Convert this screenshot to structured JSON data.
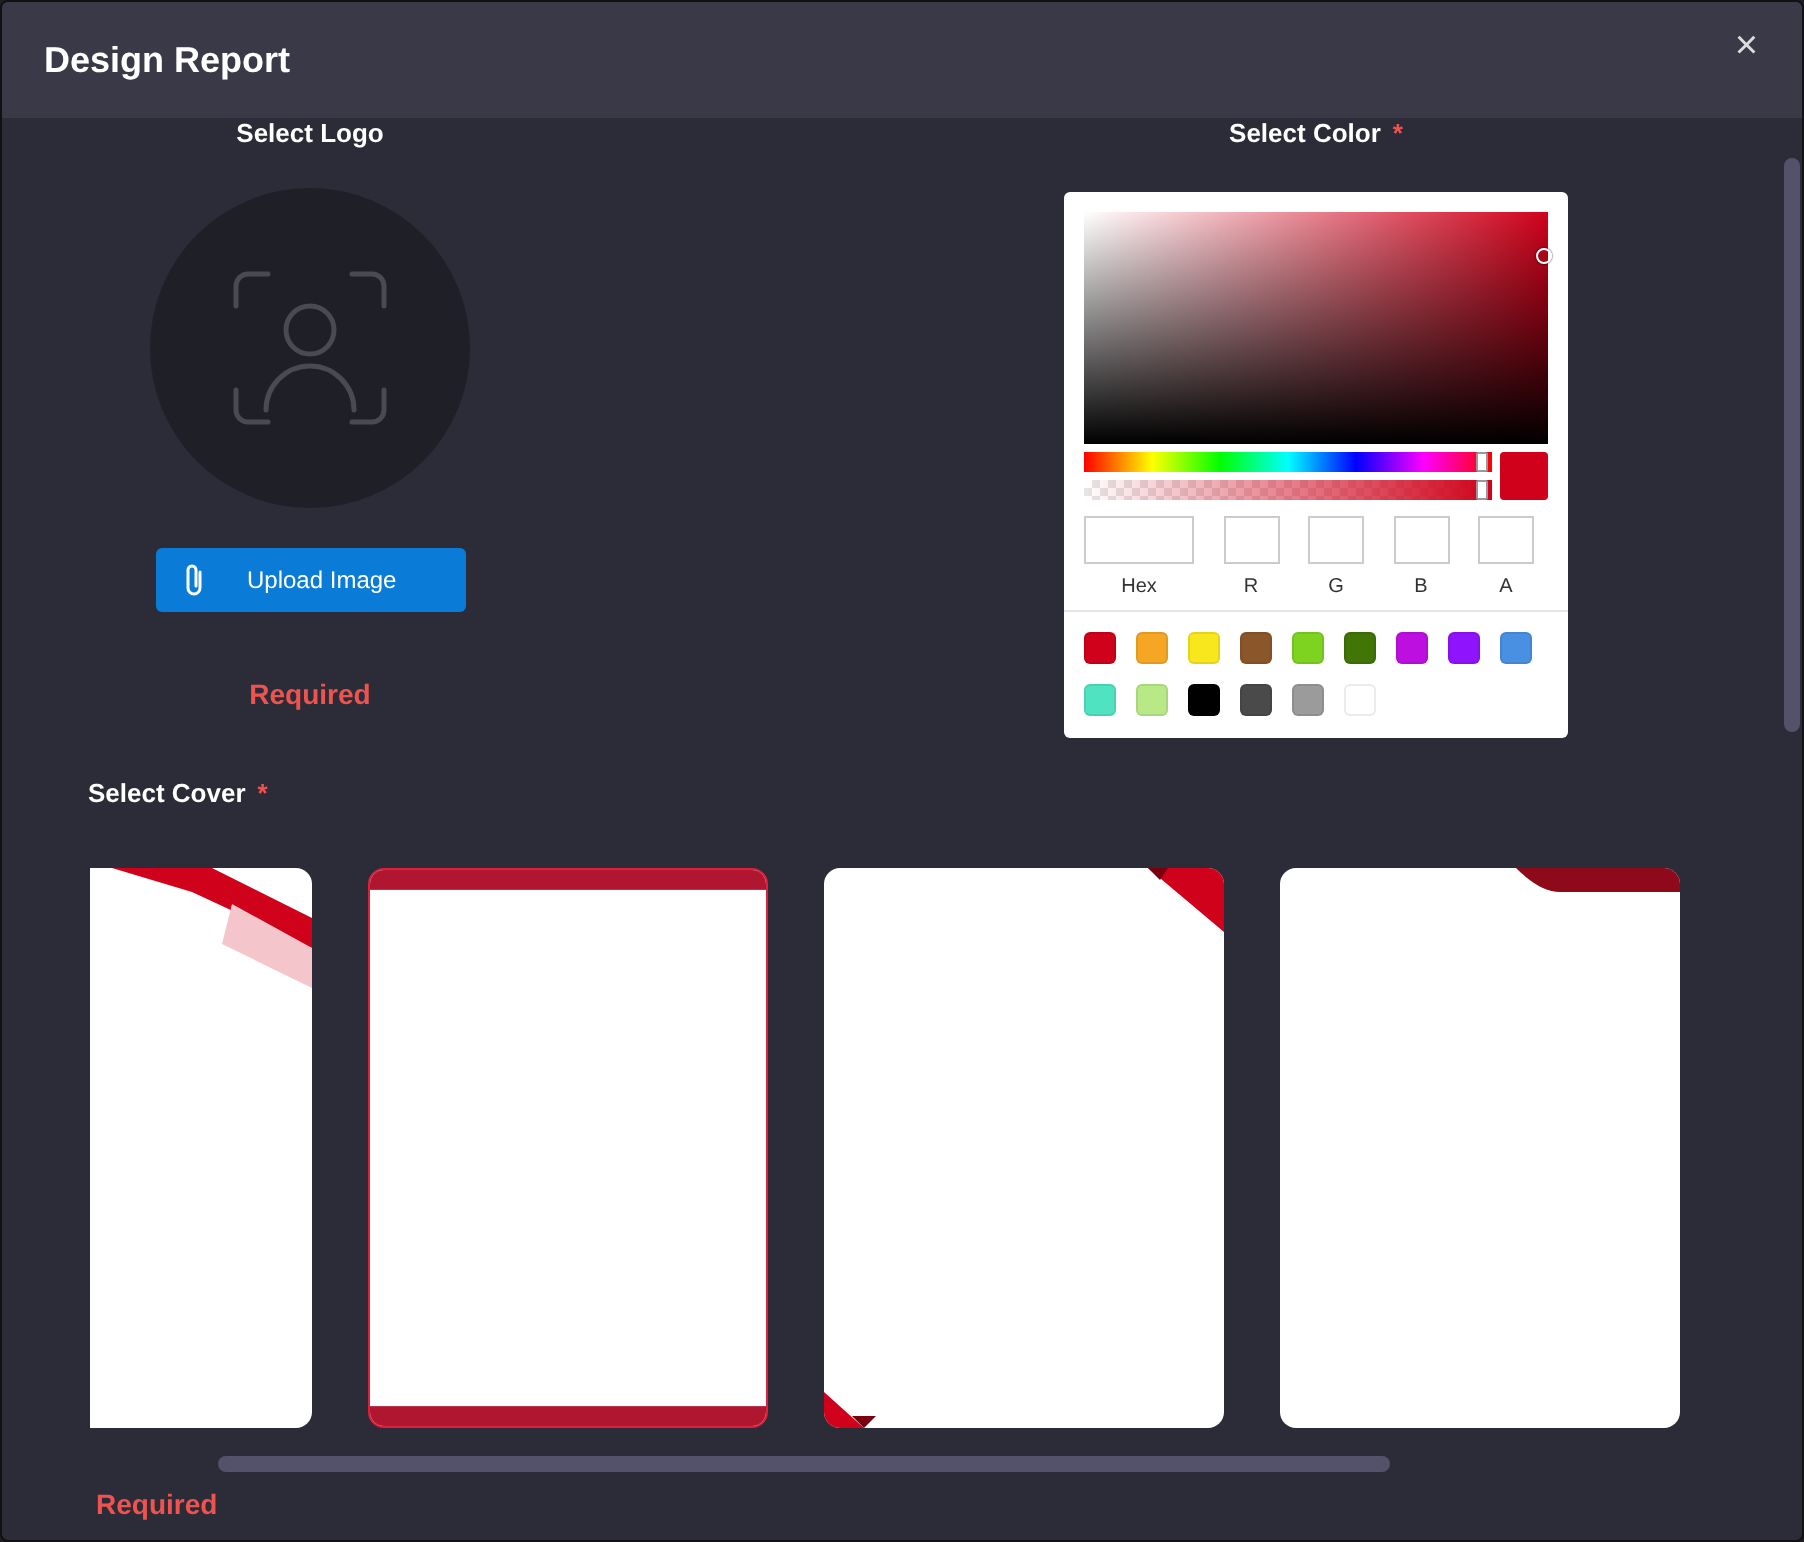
{
  "window": {
    "title": "Design Report",
    "close": "×"
  },
  "logo": {
    "label": "Select Logo",
    "button": "Upload Image",
    "error": "Required"
  },
  "color": {
    "label": "Select Color",
    "required_mark": "*",
    "preview": {
      "color": "#d0021b"
    },
    "hue": {
      "level": 0.98
    },
    "alpha": {
      "level": 0.98
    },
    "fields": [
      {
        "label": "Hex",
        "kind": "wide"
      },
      {
        "label": "R",
        "kind": "narrow"
      },
      {
        "label": "G",
        "kind": "narrow"
      },
      {
        "label": "B",
        "kind": "narrow"
      },
      {
        "label": "A",
        "kind": "narrow"
      }
    ],
    "swatches": [
      {
        "color": "#d0021b"
      },
      {
        "color": "#f5a623"
      },
      {
        "color": "#f8e71c"
      },
      {
        "color": "#8b572a"
      },
      {
        "color": "#7ed321"
      },
      {
        "color": "#417505"
      },
      {
        "color": "#bd10e0"
      },
      {
        "color": "#9013fe"
      },
      {
        "color": "#4a90e2"
      },
      {
        "color": "#50e3c2"
      },
      {
        "color": "#b8e986"
      },
      {
        "color": "#000000"
      },
      {
        "color": "#4a4a4a"
      },
      {
        "color": "#9b9b9b"
      },
      {
        "color": "#ffffff"
      }
    ]
  },
  "cover": {
    "label": "Select Cover",
    "required_mark": "*",
    "error": "Required",
    "items": [
      {
        "kind": "ribbon",
        "selected": false
      },
      {
        "kind": "band",
        "selected": true
      },
      {
        "kind": "corner",
        "selected": false
      },
      {
        "kind": "wave",
        "selected": false
      }
    ]
  }
}
